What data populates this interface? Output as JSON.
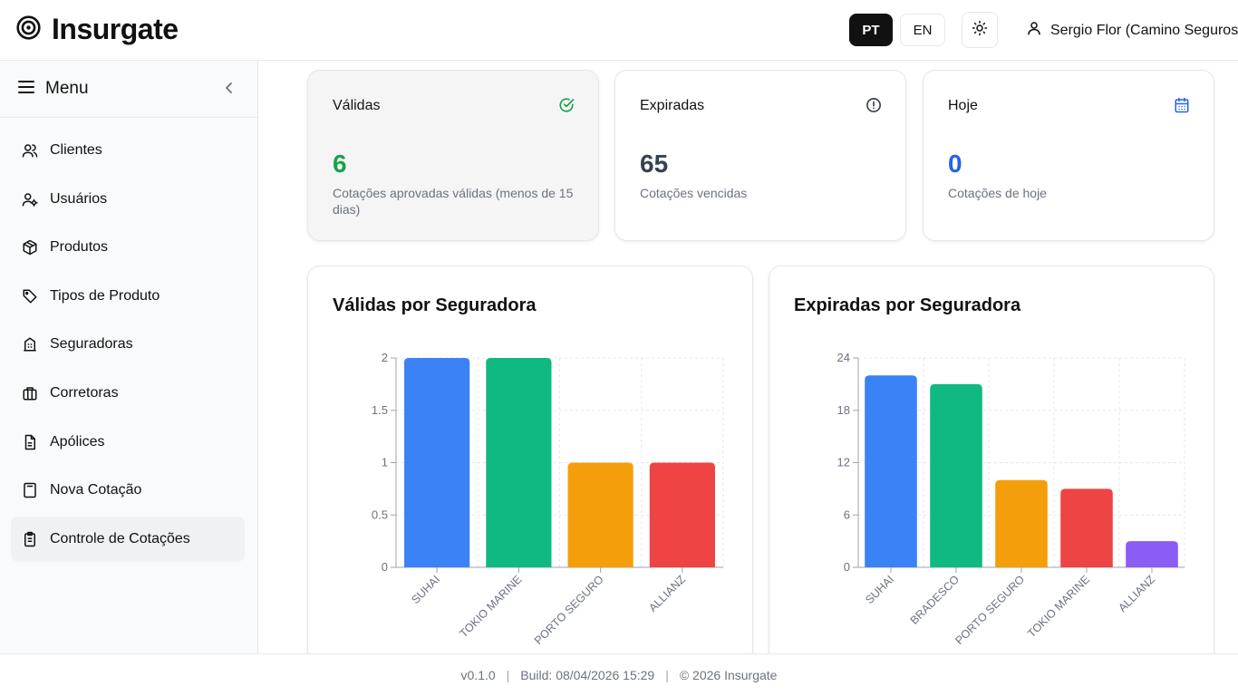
{
  "app": {
    "name": "Insurgate"
  },
  "header": {
    "lang_pt": "PT",
    "lang_en": "EN",
    "user_name": "Sergio Flor (Camino Seguros)"
  },
  "sidebar": {
    "title": "Menu",
    "items": [
      {
        "label": "Clientes",
        "icon": "users-icon"
      },
      {
        "label": "Usuários",
        "icon": "user-cog-icon"
      },
      {
        "label": "Produtos",
        "icon": "package-icon"
      },
      {
        "label": "Tipos de Produto",
        "icon": "tag-icon"
      },
      {
        "label": "Seguradoras",
        "icon": "building-icon"
      },
      {
        "label": "Corretoras",
        "icon": "briefcase-icon"
      },
      {
        "label": "Apólices",
        "icon": "document-icon"
      },
      {
        "label": "Nova Cotação",
        "icon": "calculator-icon"
      },
      {
        "label": "Controle de Cotações",
        "icon": "clipboard-icon",
        "active": true
      }
    ]
  },
  "stats": [
    {
      "title": "Válidas",
      "value": "6",
      "desc": "Cotações aprovadas válidas (menos de 15 dias)",
      "color": "#16a34a",
      "icon": "check-circle-icon"
    },
    {
      "title": "Expiradas",
      "value": "65",
      "desc": "Cotações vencidas",
      "color": "#374151",
      "icon": "alert-circle-icon"
    },
    {
      "title": "Hoje",
      "value": "0",
      "desc": "Cotações de hoje",
      "color": "#2563eb",
      "icon": "calendar-icon"
    }
  ],
  "chart_data": [
    {
      "type": "bar",
      "title": "Válidas por Seguradora",
      "categories": [
        "SUHAI",
        "TOKIO MARINE",
        "PORTO SEGURO",
        "ALLIANZ"
      ],
      "values": [
        2,
        2,
        1,
        1
      ],
      "colors": [
        "#3b82f6",
        "#10b981",
        "#f59e0b",
        "#ef4444"
      ],
      "yticks": [
        "0",
        "0.5",
        "1",
        "1.5",
        "2"
      ],
      "ylim": [
        0,
        2
      ],
      "grid": true
    },
    {
      "type": "bar",
      "title": "Expiradas por Seguradora",
      "categories": [
        "SUHAI",
        "BRADESCO",
        "PORTO SEGURO",
        "TOKIO MARINE",
        "ALLIANZ"
      ],
      "values": [
        22,
        21,
        10,
        9,
        3
      ],
      "colors": [
        "#3b82f6",
        "#10b981",
        "#f59e0b",
        "#ef4444",
        "#8b5cf6"
      ],
      "yticks": [
        "0",
        "6",
        "12",
        "18",
        "24"
      ],
      "ylim": [
        0,
        24
      ],
      "grid": true
    }
  ],
  "footer": {
    "version": "v0.1.0",
    "build": "Build: 08/04/2026 15:29",
    "copyright": "© 2026 Insurgate"
  }
}
